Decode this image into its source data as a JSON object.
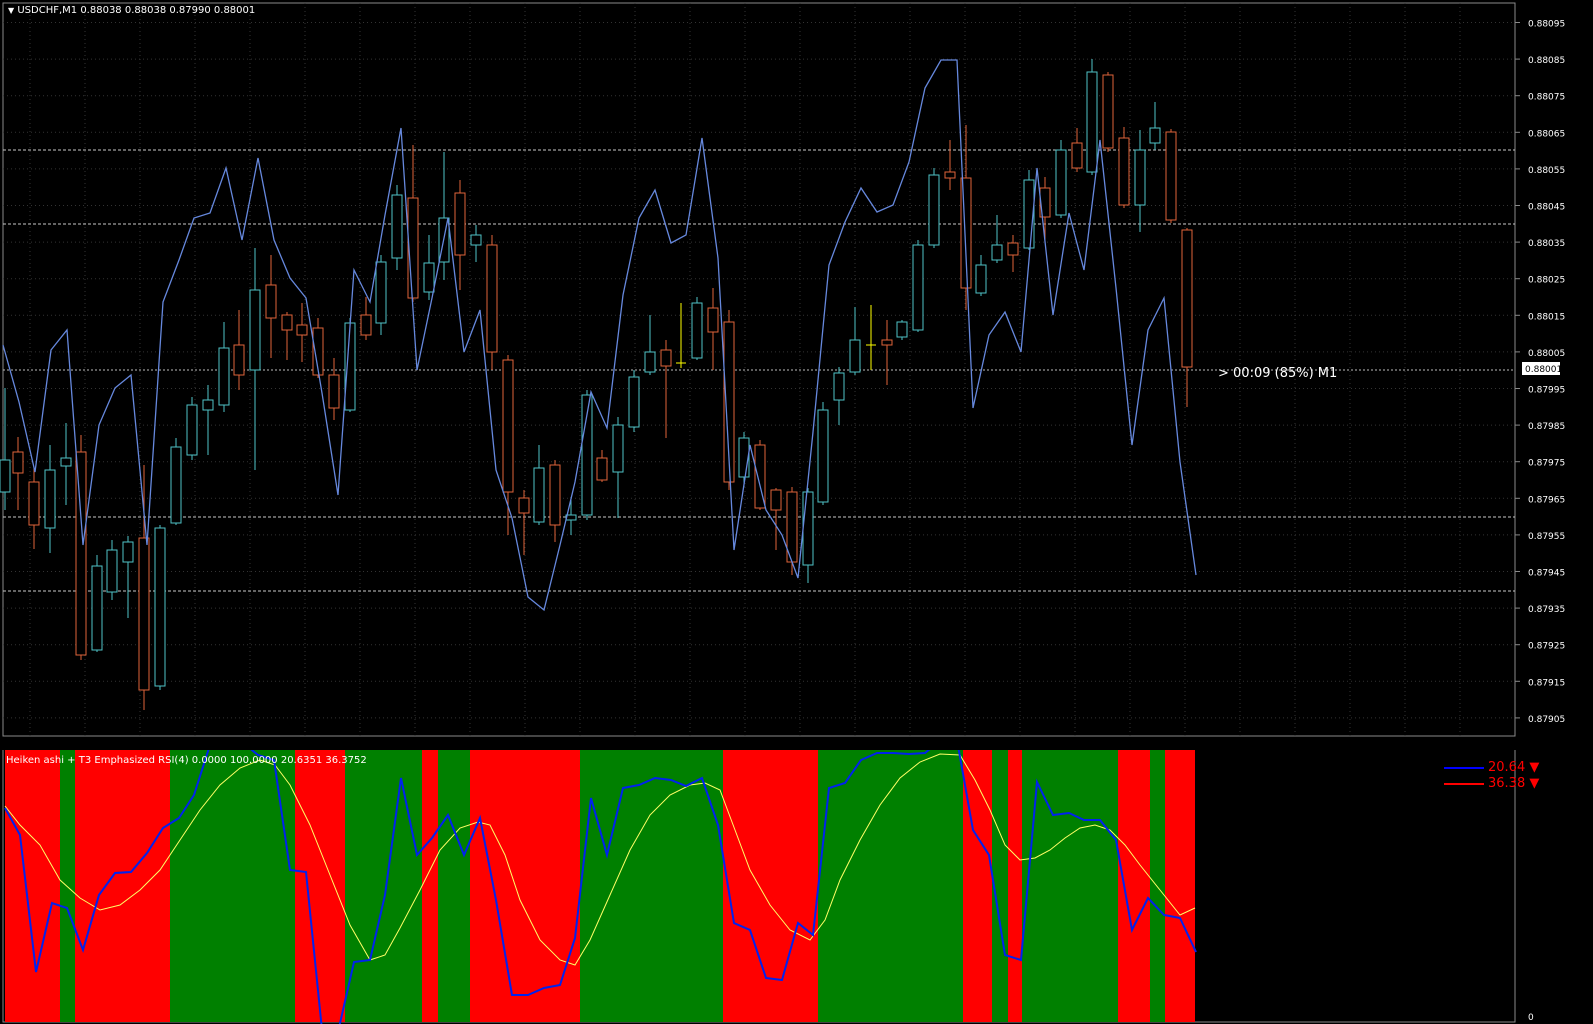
{
  "chart": {
    "symbol_header": "USDCHF,M1  0.88038 0.88038 0.87990 0.88001",
    "dropdown_glyph": "▼",
    "price_ticks": [
      "0.88095",
      "0.88085",
      "0.88075",
      "0.88065",
      "0.88055",
      "0.88045",
      "0.88035",
      "0.88025",
      "0.88015",
      "0.88005",
      "0.87995",
      "0.87985",
      "0.87975",
      "0.87965",
      "0.87955",
      "0.87945",
      "0.87935",
      "0.87925",
      "0.87915",
      "0.87905"
    ],
    "current_price": "0.88001",
    "timer": "> 00:09 (85%) M1",
    "colors": {
      "bull": "#4fc3c7",
      "bear": "#e0643a",
      "doji": "#ffff00",
      "line": "#6688dd",
      "grid": "#333333",
      "hline": "#c8c8c8"
    }
  },
  "indicator": {
    "title": "Heiken ashi + T3 Emphasized RSI(4) 0.0000 100.0000 20.6351 36.3752",
    "scale_top": "100",
    "scale_bottom": "0",
    "legend": [
      {
        "value": "20.64",
        "arrow": "▼",
        "color": "#0000ff"
      },
      {
        "value": "36.38",
        "arrow": "▼",
        "color": "#ff0000"
      }
    ],
    "colors": {
      "up": "#008000",
      "down": "#ff0000",
      "rsi": "#0022ee",
      "t3": "#ffff66"
    }
  }
}
